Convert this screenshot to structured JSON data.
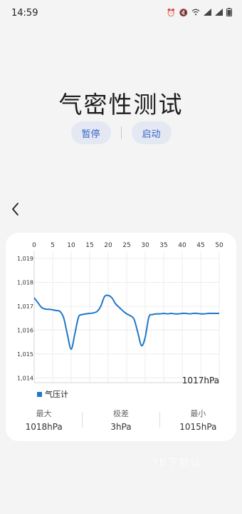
{
  "status_bar": {
    "time": "14:59",
    "icons": [
      "alarm-icon",
      "mute-icon",
      "wifi-icon",
      "signal-icon",
      "signal-icon",
      "battery-icon"
    ]
  },
  "page": {
    "title": "气密性测试",
    "pause_label": "暂停",
    "start_label": "启动",
    "back_icon": "chevron-left-icon"
  },
  "chart": {
    "unit_label": "1017hPa",
    "legend_label": "气压计",
    "series_color": "#1f77c8"
  },
  "chart_data": {
    "type": "line",
    "x_ticks": [
      "0",
      "5",
      "10",
      "15",
      "20",
      "25",
      "30",
      "35",
      "40",
      "45",
      "50"
    ],
    "y_ticks": [
      "1,019",
      "1,018",
      "1,017",
      "1,016",
      "1,015",
      "1,014"
    ],
    "xlim": [
      0,
      50
    ],
    "ylim": [
      1013.8,
      1019.3
    ],
    "grid": true,
    "legend_position": "bottom-left",
    "series": [
      {
        "name": "气压计",
        "x": [
          0,
          1,
          2,
          3,
          4,
          5,
          6,
          7,
          8,
          9,
          10,
          11,
          12,
          13,
          14,
          15,
          16,
          17,
          18,
          19,
          20,
          21,
          22,
          23,
          24,
          25,
          26,
          27,
          28,
          29,
          30,
          31,
          32,
          33,
          34,
          35,
          36,
          37,
          38,
          39,
          40,
          41,
          42,
          43,
          44,
          45,
          46,
          47,
          48,
          49,
          50
        ],
        "y": [
          1017.35,
          1017.15,
          1016.95,
          1016.88,
          1016.87,
          1016.85,
          1016.82,
          1016.78,
          1016.5,
          1015.8,
          1015.2,
          1015.85,
          1016.55,
          1016.65,
          1016.68,
          1016.7,
          1016.72,
          1016.78,
          1017.0,
          1017.4,
          1017.45,
          1017.35,
          1017.1,
          1016.95,
          1016.8,
          1016.68,
          1016.6,
          1016.45,
          1015.9,
          1015.35,
          1015.7,
          1016.55,
          1016.65,
          1016.68,
          1016.68,
          1016.7,
          1016.68,
          1016.7,
          1016.68,
          1016.68,
          1016.7,
          1016.7,
          1016.68,
          1016.7,
          1016.7,
          1016.68,
          1016.68,
          1016.7,
          1016.7,
          1016.7,
          1016.7
        ]
      }
    ]
  },
  "stats": {
    "max_label": "最大",
    "max_value": "1018hPa",
    "range_label": "极差",
    "range_value": "3hPa",
    "min_label": "最小",
    "min_value": "1015hPa"
  },
  "watermark": "7B下载站"
}
